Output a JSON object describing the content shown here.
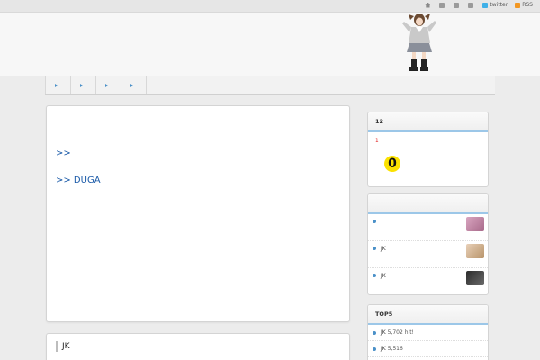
{
  "topnav": {
    "items": [
      {
        "label": "",
        "icon": "home-icon"
      },
      {
        "label": "",
        "icon": "document-icon"
      },
      {
        "label": "",
        "icon": "document-icon"
      },
      {
        "label": "",
        "icon": "mail-icon"
      },
      {
        "label": "twitter",
        "icon": "twitter-icon"
      },
      {
        "label": "RSS",
        "icon": "rss-icon"
      }
    ]
  },
  "header": {
    "title": "",
    "description": ""
  },
  "nav": {
    "items": [
      {
        "label": ""
      },
      {
        "label": ""
      },
      {
        "label": ""
      },
      {
        "label": ""
      }
    ]
  },
  "main": {
    "post_title": "",
    "lines": [
      "",
      "",
      "",
      "",
      "",
      ""
    ],
    "link1": ">>",
    "link2": ">> DUGA",
    "second_title": "JK"
  },
  "sidebar": {
    "widget1": {
      "title": "12",
      "red_line1": "1",
      "red_line2": "",
      "banner_small": "",
      "banner_big": "",
      "banner_zero": "0"
    },
    "widget2": {
      "title": "",
      "items": [
        {
          "text": ""
        },
        {
          "text": "JK"
        },
        {
          "text": "JK"
        }
      ]
    },
    "widget3": {
      "title": "TOP5",
      "items": [
        {
          "text": "JK",
          "hits": "5,702 hit!"
        },
        {
          "text": "JK",
          "hits": "5,516"
        }
      ]
    }
  },
  "colors": {
    "accent": "#4a90c8",
    "link": "#1a5aa8",
    "red": "#e02020",
    "yellow": "#fbe100",
    "twitter": "#3fb0e8",
    "rss": "#f29722"
  }
}
